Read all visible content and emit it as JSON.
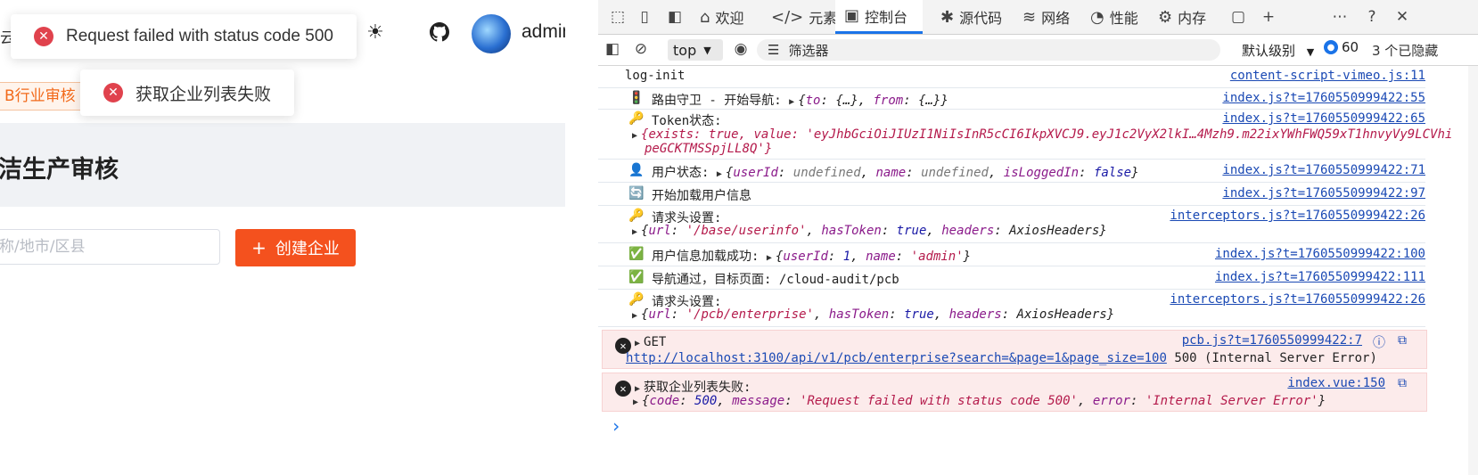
{
  "app": {
    "username": "admin",
    "tab_active": "B行业审核",
    "title": "洁生产审核",
    "search_placeholder": "称/地市/区县",
    "create_button": "创建企业",
    "toasts": [
      "Request failed with status code 500",
      "获取企业列表失败"
    ],
    "stub_text": "云"
  },
  "devtools": {
    "tabs": [
      "欢迎",
      "元素",
      "控制台",
      "源代码",
      "网络",
      "性能",
      "内存"
    ],
    "top_context": "top",
    "filter_placeholder": "筛选器",
    "level": "默认级别",
    "issue_count": "60",
    "hidden": "3 个已隐藏"
  },
  "console": {
    "rows": [
      {
        "text": "log-init",
        "src": "content-script-vimeo.js:11"
      },
      {
        "text": "路由守卫 - 开始导航:",
        "obj": "{to: {…}, from: {…}}",
        "src": "index.js?t=1760550999422:55"
      },
      {
        "text": "Token状态:",
        "src": "index.js?t=1760550999422:65",
        "detail_pre": "{exists: true, value: 'eyJhbGciOiJIUzI1NiIsInR5cCI6IkpXVCJ9.eyJ1c2VyX2lkI…4Mzh9.m22ixYWhFWQ59xT1hnvyVy9LCVhi",
        "detail_post": "peGCKTMSSpjLL8Q'}"
      },
      {
        "text": "用户状态:",
        "src": "index.js?t=1760550999422:71"
      },
      {
        "text": "开始加载用户信息",
        "src": "index.js?t=1760550999422:97"
      },
      {
        "text": "请求头设置:",
        "src": "interceptors.js?t=1760550999422:26",
        "detail": "/base/userinfo"
      },
      {
        "text": "用户信息加载成功:",
        "src": "index.js?t=1760550999422:100"
      },
      {
        "text": "导航通过，目标页面: /cloud-audit/pcb",
        "src": "index.js?t=1760550999422:111"
      },
      {
        "text": "请求头设置:",
        "src": "interceptors.js?t=1760550999422:26",
        "detail": "/pcb/enterprise"
      }
    ],
    "errors": [
      {
        "title": "GET",
        "src": "pcb.js?t=1760550999422:7",
        "url": "http://localhost:3100/api/v1/pcb/enterprise?search=&page=1&page_size=100",
        "status": "500 (Internal Server Error)"
      },
      {
        "title": "获取企业列表失败:",
        "src": "index.vue:150",
        "code": "500",
        "message": "'Request failed with status code 500'",
        "error": "'Internal Server Error'"
      }
    ]
  }
}
